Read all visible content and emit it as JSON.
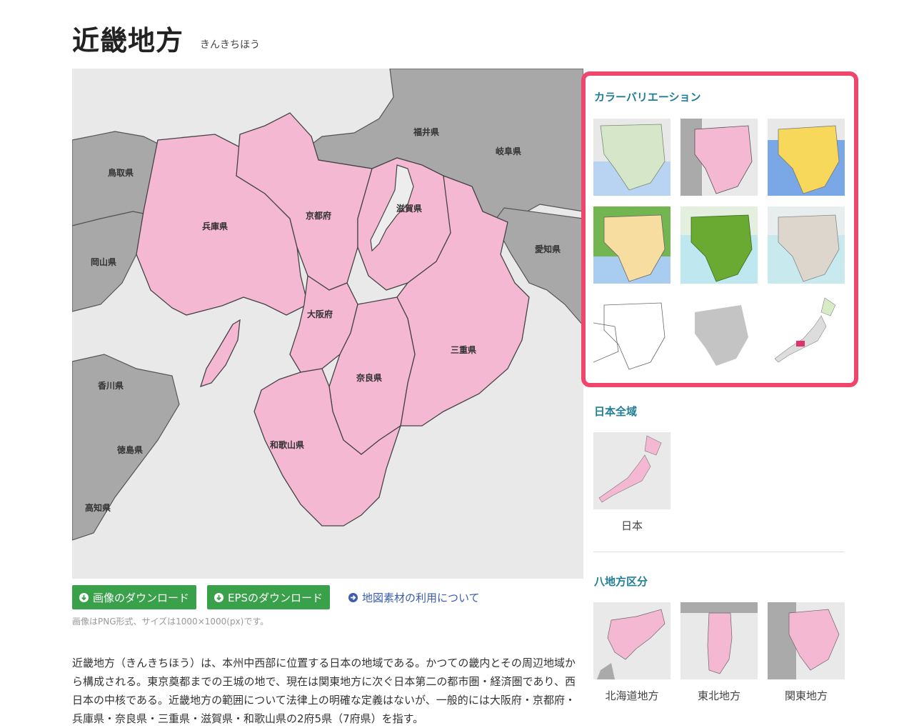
{
  "page": {
    "title": "近畿地方",
    "reading": "きんきちほう"
  },
  "map": {
    "labels": {
      "fukui": "福井県",
      "gifu": "岐阜県",
      "tottori": "鳥取県",
      "kyoto": "京都府",
      "shiga": "滋賀県",
      "hyogo": "兵庫県",
      "okayama": "岡山県",
      "aichi": "愛知県",
      "osaka": "大阪府",
      "mie": "三重県",
      "kagawa": "香川県",
      "nara": "奈良県",
      "tokushima": "徳島県",
      "wakayama": "和歌山県",
      "kochi": "高知県"
    },
    "colors": {
      "kinki": "#f5b8d2",
      "neighbors": "#a8a8a8",
      "sea": "#e9e9e9",
      "shiga": "#ededed"
    }
  },
  "actions": {
    "download_image": "画像のダウンロード",
    "download_eps": "EPSのダウンロード",
    "usage_link": "地図素材の利用について"
  },
  "note": "画像はPNG形式、サイズは1000×1000(px)です。",
  "description": "近畿地方（きんきちほう）は、本州中西部に位置する日本の地域である。かつての畿内とその周辺地域から構成される。東京奠都までの王城の地で、現在は関東地方に次ぐ日本第二の都市圏・経済圏であり、西日本の中核である。近畿地方の範囲について法律上の明確な定義はないが、一般的には大阪府・京都府・兵庫県・奈良県・三重県・滋賀県・和歌山県の2府5県（7府県）を指す。",
  "sidebar": {
    "variations_title": "カラーバリエーション",
    "japan_title": "日本全域",
    "japan_items": [
      {
        "caption": "日本"
      }
    ],
    "regions_title": "八地方区分",
    "region_items": [
      {
        "caption": "北海道地方"
      },
      {
        "caption": "東北地方"
      },
      {
        "caption": "関東地方"
      }
    ]
  }
}
